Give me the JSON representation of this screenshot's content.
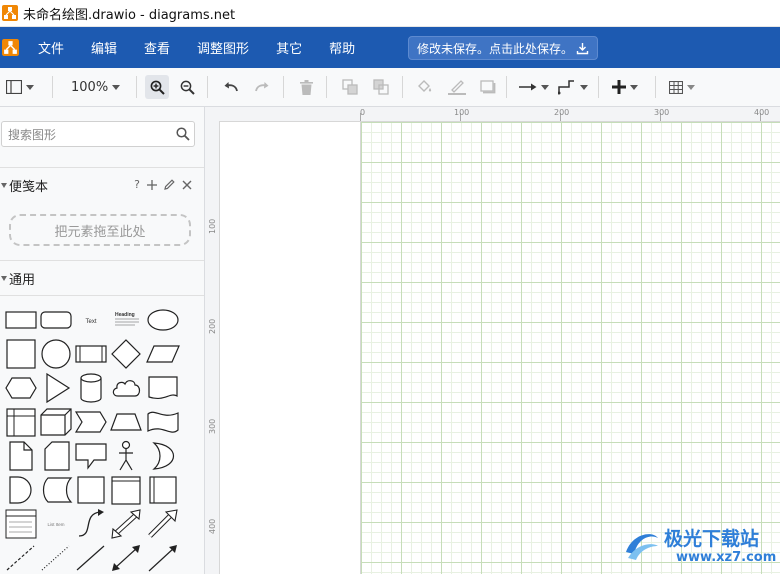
{
  "window": {
    "title": "未命名绘图.drawio - diagrams.net"
  },
  "menubar": {
    "items": [
      "文件",
      "编辑",
      "查看",
      "调整图形",
      "其它",
      "帮助"
    ],
    "save_banner": "修改未保存。点击此处保存。",
    "background": "#1d5ab1"
  },
  "toolbar": {
    "zoom": "100%"
  },
  "sidebar": {
    "search": {
      "placeholder": "搜索图形",
      "value": ""
    },
    "scratchpad": {
      "title": "便笺本",
      "help": "?",
      "drop_hint": "把元素拖至此处"
    },
    "general": {
      "title": "通用",
      "shape_text_labels": {
        "text": "Text",
        "heading": "Heading",
        "list": "List Item"
      }
    }
  },
  "rulers": {
    "top": [
      "0",
      "100",
      "200",
      "300",
      "400"
    ],
    "left": [
      "100",
      "200",
      "300",
      "400"
    ]
  },
  "watermark": {
    "title": "极光下载站",
    "url": "www.xz7.com"
  },
  "colors": {
    "accent": "#1d5ab1",
    "grid_major": "#c6ddb9",
    "grid_minor": "#e8f1e2"
  }
}
